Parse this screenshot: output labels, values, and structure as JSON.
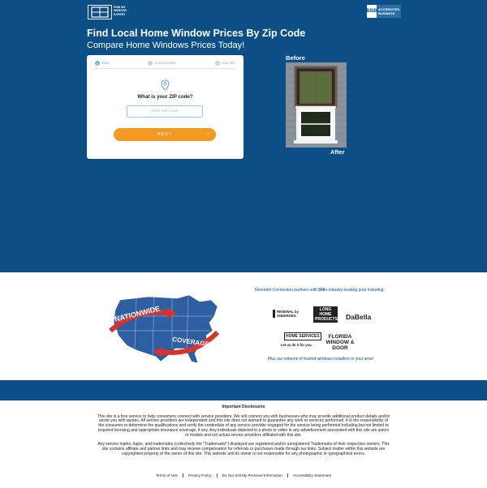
{
  "header": {
    "logo_text": "FIND MY WINDOW EXPERT",
    "bbb_seal": "BBB",
    "bbb_text": "ACCREDITED BUSINESS"
  },
  "hero": {
    "headline": "Find Local Home Window Prices By Zip Code",
    "subheadline": "Compare Home Windows Prices Today!",
    "before_label": "Before",
    "after_label": "After"
  },
  "form": {
    "steps": [
      {
        "num": "1",
        "label": "Start"
      },
      {
        "num": "2",
        "label": "Home Details"
      },
      {
        "num": "3",
        "label": "Your Info"
      }
    ],
    "question": "What is your ZIP code?",
    "zip_placeholder": "Enter ZIP Code",
    "zip_value": "",
    "next_label": "NEXT",
    "next_arrow": "→"
  },
  "coverage": {
    "map_word_1": "NATIONWIDE",
    "map_word_2": "COVERAGE",
    "partners_intro_prefix": "Remodel Connection partners with ",
    "partners_count": "500+",
    "partners_intro_suffix": " industry-leading pros including:",
    "partners": [
      {
        "name": "RENEWAL by ANDERSEN"
      },
      {
        "name": "LONG HOME PRODUCTS"
      },
      {
        "name": "DaBella"
      },
      {
        "name": "HOME SERVICES"
      },
      {
        "name": "Let us do it for you."
      },
      {
        "name": "FLORIDA WINDOW & DOOR"
      }
    ],
    "network_text": "Plus our network of trusted windows installers in your area!"
  },
  "disclosures": {
    "title": "Important Disclosures",
    "p1": "This site is a free service to help consumers connect with service providers. We will connect you with businesses who may provide additional product details and/or assist you with quotes. All service providers are independent and this site does not warrant or guarantee any work or services performed. It is the responsibility of the consumer to determine the qualifications and verify the credentials of any service provider engaged for the service being performed including but not limited to required licensing and appropriate insurance coverage, if any. Any individuals depicted in a photo or video in any advertisement associated with this site are actors or models and not actual service providers affiliated with this site.",
    "p2": "Any service marks, logos, and trademarks (collectively the \"Trademarks\") displayed are registered and/or unregistered Trademarks of their respective owners. This site contains affiliate and partner links and may receive compensation for referrals or purchases made through our links. Subject matter within this website are copyrighted property of the owner of this site. This website and its owner is not responsible for any photographic or typographical errors."
  },
  "footer": {
    "links": [
      "Terms of Use",
      "Privacy Policy",
      "Do Not Sell My Personal Information",
      "Accessibility Statement"
    ]
  },
  "colors": {
    "brand_blue": "#0b4f86",
    "accent_orange": "#f39a22",
    "step_active": "#6bb9d8",
    "map_red": "#d9342b"
  }
}
